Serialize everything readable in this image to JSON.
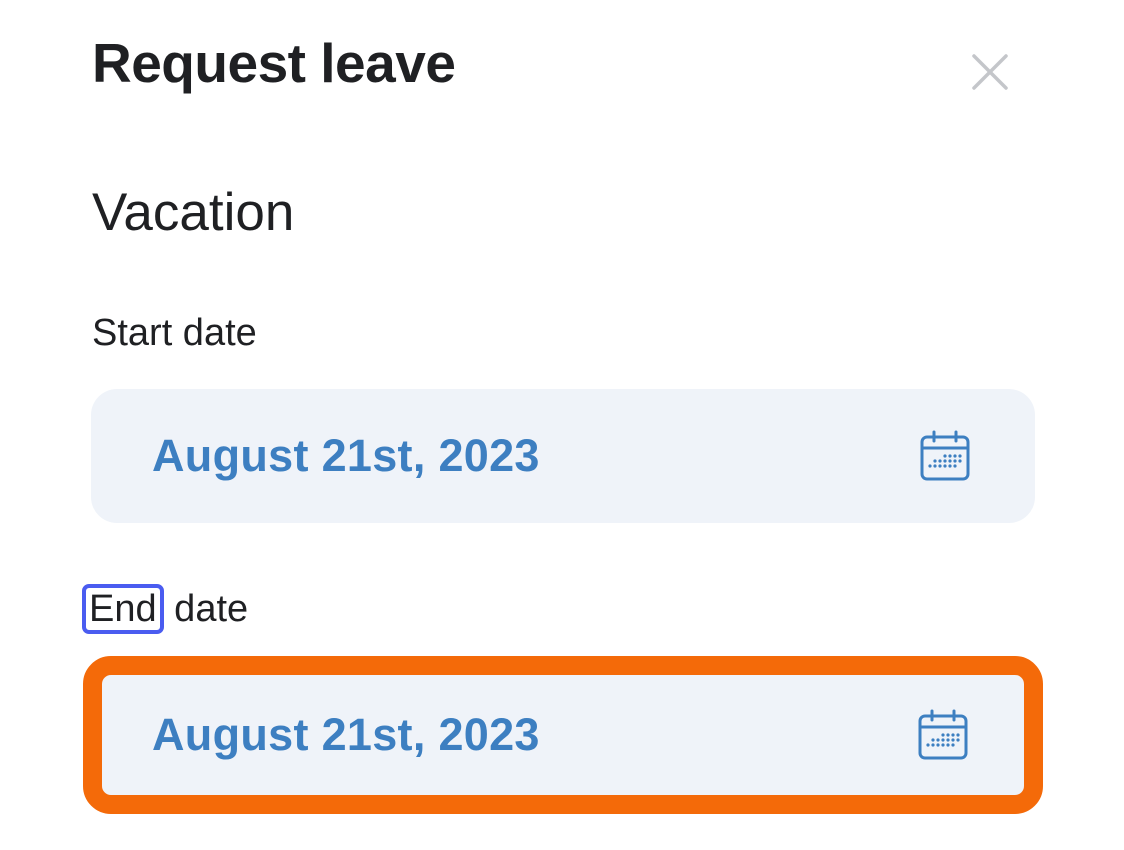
{
  "header": {
    "title": "Request leave",
    "close_icon": "close-icon"
  },
  "leave_type": "Vacation",
  "start": {
    "label": "Start date",
    "value": "August 21st, 2023",
    "icon": "calendar-icon"
  },
  "end": {
    "label_word_highlighted": "End",
    "label_rest": " date",
    "value": "August 21st, 2023",
    "icon": "calendar-icon"
  },
  "colors": {
    "value_text": "#3d7fc1",
    "field_bg": "#eff3f9",
    "focus_outline": "#f46a09",
    "label_highlight": "#4a5cf0"
  }
}
